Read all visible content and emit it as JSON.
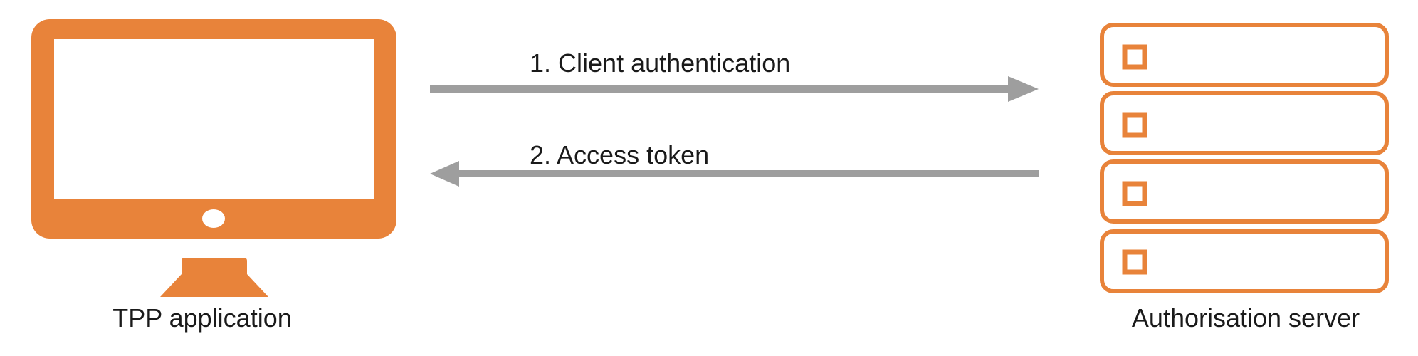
{
  "colors": {
    "accent": "#E8833A",
    "arrow": "#9E9E9E",
    "screen": "#FFFFFF",
    "text": "#1A1A1A"
  },
  "nodes": {
    "client": {
      "label": "TPP application",
      "icon": "desktop-monitor-icon"
    },
    "server": {
      "label": "Authorisation server",
      "icon": "server-rack-icon"
    }
  },
  "flows": [
    {
      "label": "1. Client authentication",
      "direction": "client-to-server"
    },
    {
      "label": "2. Access token",
      "direction": "server-to-client"
    }
  ]
}
